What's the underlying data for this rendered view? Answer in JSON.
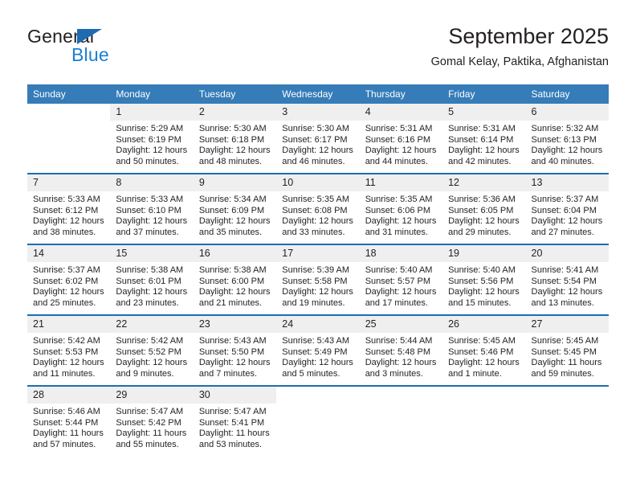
{
  "brand": {
    "name_top": "General",
    "name_bottom": "Blue",
    "triangle_icon": "blue-triangle-logo-mark",
    "color_dark": "#231f20",
    "color_blue": "#1b7fd4",
    "triangle_color": "#1e6bb0"
  },
  "header": {
    "title": "September 2025",
    "subtitle": "Gomal Kelay, Paktika, Afghanistan"
  },
  "theme": {
    "header_bg": "#357cb8",
    "week_divider": "#1d6eaf",
    "daynum_bg": "#efefef",
    "text": "#231f20"
  },
  "weekday_headers": [
    "Sunday",
    "Monday",
    "Tuesday",
    "Wednesday",
    "Thursday",
    "Friday",
    "Saturday"
  ],
  "weeks": [
    [
      {
        "day": "",
        "sunrise": "",
        "sunset": "",
        "daylight_line1": "",
        "daylight_line2": "",
        "empty": true
      },
      {
        "day": "1",
        "sunrise": "Sunrise: 5:29 AM",
        "sunset": "Sunset: 6:19 PM",
        "daylight_line1": "Daylight: 12 hours",
        "daylight_line2": "and 50 minutes."
      },
      {
        "day": "2",
        "sunrise": "Sunrise: 5:30 AM",
        "sunset": "Sunset: 6:18 PM",
        "daylight_line1": "Daylight: 12 hours",
        "daylight_line2": "and 48 minutes."
      },
      {
        "day": "3",
        "sunrise": "Sunrise: 5:30 AM",
        "sunset": "Sunset: 6:17 PM",
        "daylight_line1": "Daylight: 12 hours",
        "daylight_line2": "and 46 minutes."
      },
      {
        "day": "4",
        "sunrise": "Sunrise: 5:31 AM",
        "sunset": "Sunset: 6:16 PM",
        "daylight_line1": "Daylight: 12 hours",
        "daylight_line2": "and 44 minutes."
      },
      {
        "day": "5",
        "sunrise": "Sunrise: 5:31 AM",
        "sunset": "Sunset: 6:14 PM",
        "daylight_line1": "Daylight: 12 hours",
        "daylight_line2": "and 42 minutes."
      },
      {
        "day": "6",
        "sunrise": "Sunrise: 5:32 AM",
        "sunset": "Sunset: 6:13 PM",
        "daylight_line1": "Daylight: 12 hours",
        "daylight_line2": "and 40 minutes."
      }
    ],
    [
      {
        "day": "7",
        "sunrise": "Sunrise: 5:33 AM",
        "sunset": "Sunset: 6:12 PM",
        "daylight_line1": "Daylight: 12 hours",
        "daylight_line2": "and 38 minutes."
      },
      {
        "day": "8",
        "sunrise": "Sunrise: 5:33 AM",
        "sunset": "Sunset: 6:10 PM",
        "daylight_line1": "Daylight: 12 hours",
        "daylight_line2": "and 37 minutes."
      },
      {
        "day": "9",
        "sunrise": "Sunrise: 5:34 AM",
        "sunset": "Sunset: 6:09 PM",
        "daylight_line1": "Daylight: 12 hours",
        "daylight_line2": "and 35 minutes."
      },
      {
        "day": "10",
        "sunrise": "Sunrise: 5:35 AM",
        "sunset": "Sunset: 6:08 PM",
        "daylight_line1": "Daylight: 12 hours",
        "daylight_line2": "and 33 minutes."
      },
      {
        "day": "11",
        "sunrise": "Sunrise: 5:35 AM",
        "sunset": "Sunset: 6:06 PM",
        "daylight_line1": "Daylight: 12 hours",
        "daylight_line2": "and 31 minutes."
      },
      {
        "day": "12",
        "sunrise": "Sunrise: 5:36 AM",
        "sunset": "Sunset: 6:05 PM",
        "daylight_line1": "Daylight: 12 hours",
        "daylight_line2": "and 29 minutes."
      },
      {
        "day": "13",
        "sunrise": "Sunrise: 5:37 AM",
        "sunset": "Sunset: 6:04 PM",
        "daylight_line1": "Daylight: 12 hours",
        "daylight_line2": "and 27 minutes."
      }
    ],
    [
      {
        "day": "14",
        "sunrise": "Sunrise: 5:37 AM",
        "sunset": "Sunset: 6:02 PM",
        "daylight_line1": "Daylight: 12 hours",
        "daylight_line2": "and 25 minutes."
      },
      {
        "day": "15",
        "sunrise": "Sunrise: 5:38 AM",
        "sunset": "Sunset: 6:01 PM",
        "daylight_line1": "Daylight: 12 hours",
        "daylight_line2": "and 23 minutes."
      },
      {
        "day": "16",
        "sunrise": "Sunrise: 5:38 AM",
        "sunset": "Sunset: 6:00 PM",
        "daylight_line1": "Daylight: 12 hours",
        "daylight_line2": "and 21 minutes."
      },
      {
        "day": "17",
        "sunrise": "Sunrise: 5:39 AM",
        "sunset": "Sunset: 5:58 PM",
        "daylight_line1": "Daylight: 12 hours",
        "daylight_line2": "and 19 minutes."
      },
      {
        "day": "18",
        "sunrise": "Sunrise: 5:40 AM",
        "sunset": "Sunset: 5:57 PM",
        "daylight_line1": "Daylight: 12 hours",
        "daylight_line2": "and 17 minutes."
      },
      {
        "day": "19",
        "sunrise": "Sunrise: 5:40 AM",
        "sunset": "Sunset: 5:56 PM",
        "daylight_line1": "Daylight: 12 hours",
        "daylight_line2": "and 15 minutes."
      },
      {
        "day": "20",
        "sunrise": "Sunrise: 5:41 AM",
        "sunset": "Sunset: 5:54 PM",
        "daylight_line1": "Daylight: 12 hours",
        "daylight_line2": "and 13 minutes."
      }
    ],
    [
      {
        "day": "21",
        "sunrise": "Sunrise: 5:42 AM",
        "sunset": "Sunset: 5:53 PM",
        "daylight_line1": "Daylight: 12 hours",
        "daylight_line2": "and 11 minutes."
      },
      {
        "day": "22",
        "sunrise": "Sunrise: 5:42 AM",
        "sunset": "Sunset: 5:52 PM",
        "daylight_line1": "Daylight: 12 hours",
        "daylight_line2": "and 9 minutes."
      },
      {
        "day": "23",
        "sunrise": "Sunrise: 5:43 AM",
        "sunset": "Sunset: 5:50 PM",
        "daylight_line1": "Daylight: 12 hours",
        "daylight_line2": "and 7 minutes."
      },
      {
        "day": "24",
        "sunrise": "Sunrise: 5:43 AM",
        "sunset": "Sunset: 5:49 PM",
        "daylight_line1": "Daylight: 12 hours",
        "daylight_line2": "and 5 minutes."
      },
      {
        "day": "25",
        "sunrise": "Sunrise: 5:44 AM",
        "sunset": "Sunset: 5:48 PM",
        "daylight_line1": "Daylight: 12 hours",
        "daylight_line2": "and 3 minutes."
      },
      {
        "day": "26",
        "sunrise": "Sunrise: 5:45 AM",
        "sunset": "Sunset: 5:46 PM",
        "daylight_line1": "Daylight: 12 hours",
        "daylight_line2": "and 1 minute."
      },
      {
        "day": "27",
        "sunrise": "Sunrise: 5:45 AM",
        "sunset": "Sunset: 5:45 PM",
        "daylight_line1": "Daylight: 11 hours",
        "daylight_line2": "and 59 minutes."
      }
    ],
    [
      {
        "day": "28",
        "sunrise": "Sunrise: 5:46 AM",
        "sunset": "Sunset: 5:44 PM",
        "daylight_line1": "Daylight: 11 hours",
        "daylight_line2": "and 57 minutes."
      },
      {
        "day": "29",
        "sunrise": "Sunrise: 5:47 AM",
        "sunset": "Sunset: 5:42 PM",
        "daylight_line1": "Daylight: 11 hours",
        "daylight_line2": "and 55 minutes."
      },
      {
        "day": "30",
        "sunrise": "Sunrise: 5:47 AM",
        "sunset": "Sunset: 5:41 PM",
        "daylight_line1": "Daylight: 11 hours",
        "daylight_line2": "and 53 minutes."
      },
      {
        "day": "",
        "sunrise": "",
        "sunset": "",
        "daylight_line1": "",
        "daylight_line2": "",
        "empty": true
      },
      {
        "day": "",
        "sunrise": "",
        "sunset": "",
        "daylight_line1": "",
        "daylight_line2": "",
        "empty": true
      },
      {
        "day": "",
        "sunrise": "",
        "sunset": "",
        "daylight_line1": "",
        "daylight_line2": "",
        "empty": true
      },
      {
        "day": "",
        "sunrise": "",
        "sunset": "",
        "daylight_line1": "",
        "daylight_line2": "",
        "empty": true
      }
    ]
  ]
}
